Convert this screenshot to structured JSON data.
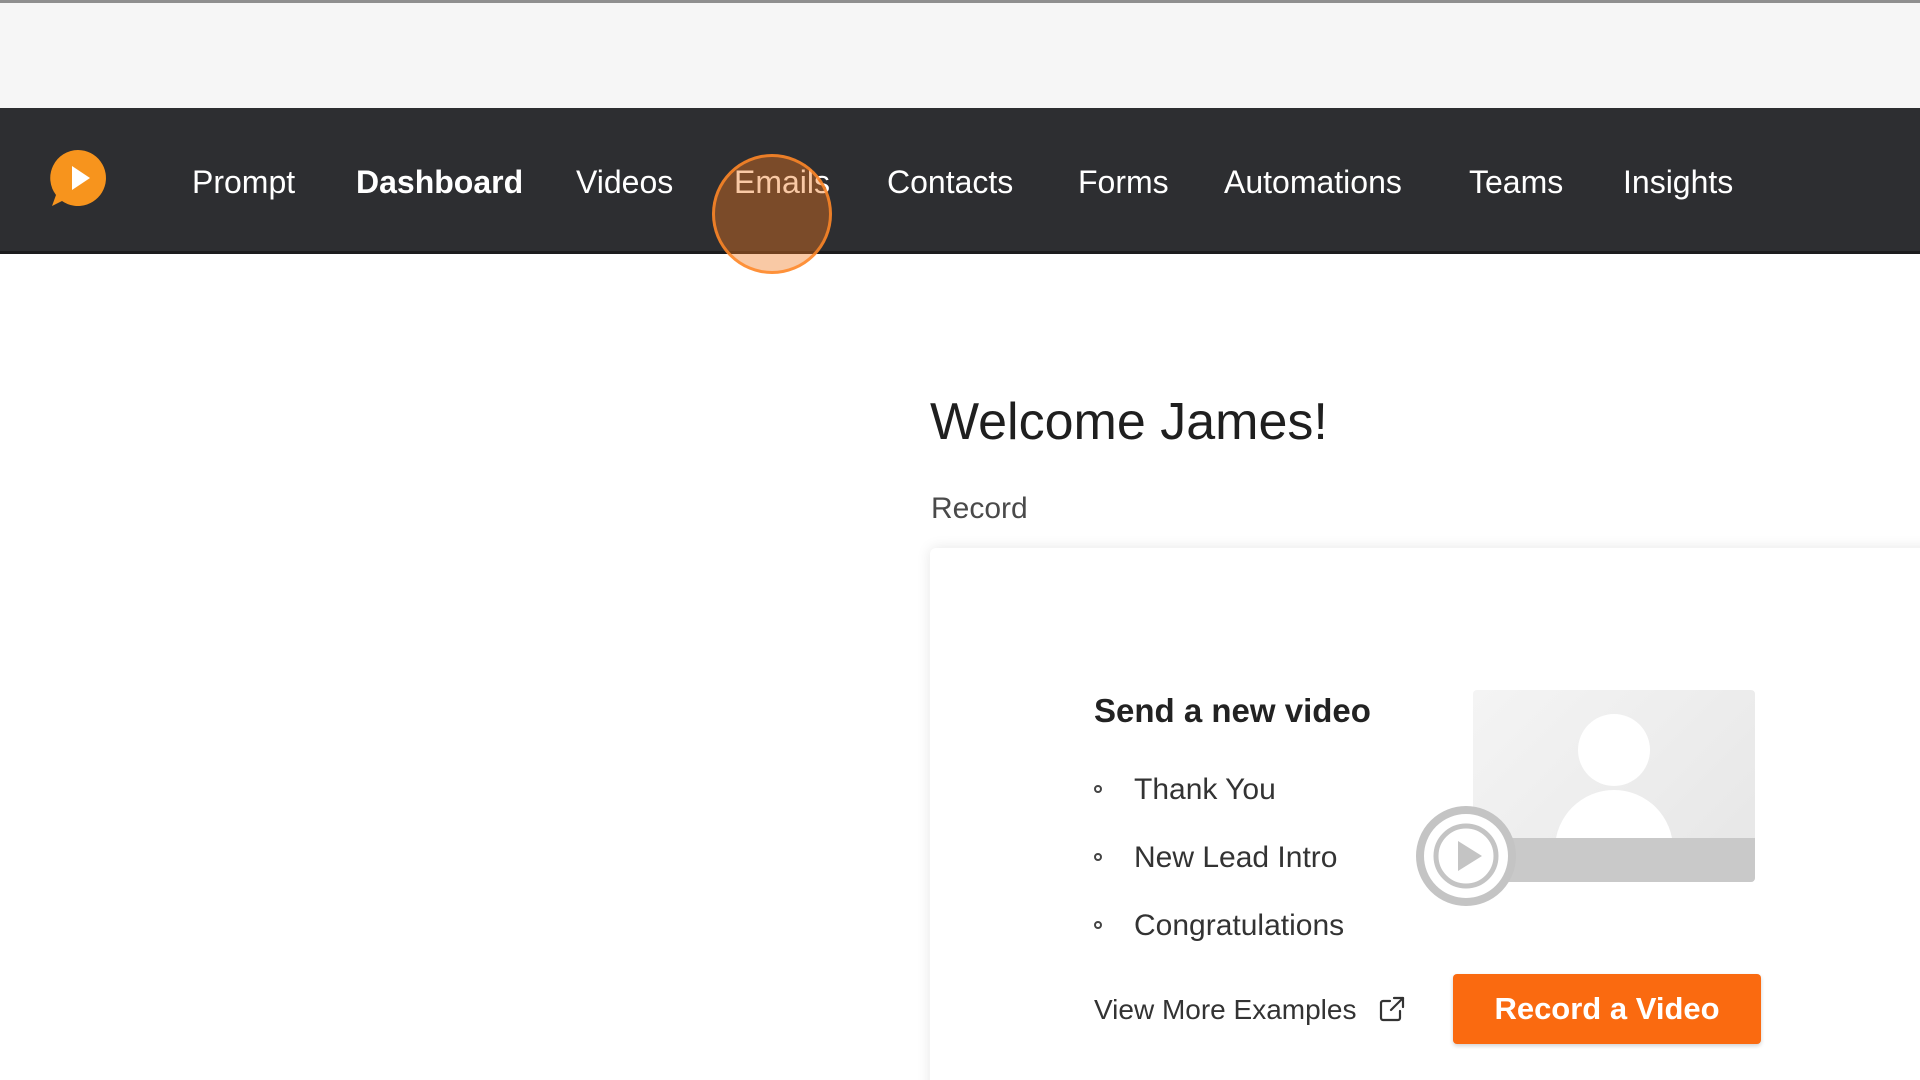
{
  "nav": {
    "items": [
      "Prompt",
      "Dashboard",
      "Videos",
      "Emails",
      "Contacts",
      "Forms",
      "Automations",
      "Teams",
      "Insights"
    ],
    "active": "Dashboard",
    "brand_color": "#f7941d",
    "bar_color": "#2d2e31"
  },
  "main": {
    "welcome": "Welcome James!",
    "section_label": "Record",
    "card": {
      "title": "Send a new video",
      "examples": [
        "Thank You",
        "New Lead Intro",
        "Congratulations"
      ],
      "view_more": "View More Examples",
      "record_button": "Record a Video",
      "button_color": "#fa6a10"
    }
  },
  "icons": {
    "logo": "play-chat-bubble-icon",
    "external_link": "external-link-icon",
    "thumbnail": "person-placeholder-icon",
    "play": "play-icon"
  }
}
